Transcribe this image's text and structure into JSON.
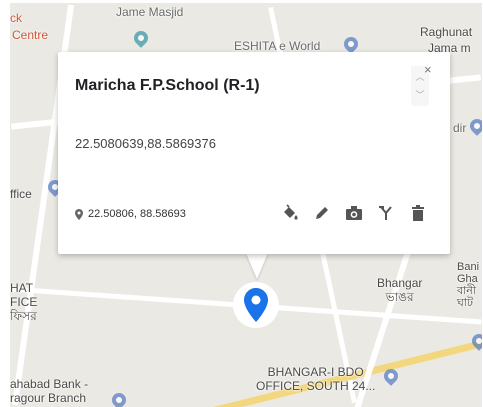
{
  "map": {
    "labels": [
      {
        "id": "centre-label-a",
        "text": "ck"
      },
      {
        "id": "centre-label-b",
        "text": "Centre"
      },
      {
        "id": "jame-masjid",
        "text": "Jame Masjid"
      },
      {
        "id": "eshita-world",
        "text": "ESHITA e World"
      },
      {
        "id": "raghunath-a",
        "text": "Raghunat"
      },
      {
        "id": "raghunath-b",
        "text": "Jama m"
      },
      {
        "id": "dir-fragment",
        "text": "dir"
      },
      {
        "id": "office-fragment",
        "text": "ffice"
      },
      {
        "id": "hat-office",
        "text": "HAT\nFICE\nফিসর"
      },
      {
        "id": "bhangar",
        "text": "Bhangar\nভাঙর"
      },
      {
        "id": "bani-fragment",
        "text": "Bani\nGha\nবানী\nঘাট"
      },
      {
        "id": "bhangar-bdo",
        "text": "BHANGAR-I BDO\nOFFICE, SOUTH 24..."
      },
      {
        "id": "bahabad-bank",
        "text": "ahabad Bank -\nragour Branch"
      }
    ]
  },
  "popup": {
    "title": "Maricha F.P.School (R-1)",
    "coordinates_full": "22.5080639,88.5869376",
    "coordinates_short": "22.50806, 88.58693",
    "close_glyph": "×"
  },
  "colors": {
    "marker": "#1a73e8",
    "icon": "#555555"
  }
}
